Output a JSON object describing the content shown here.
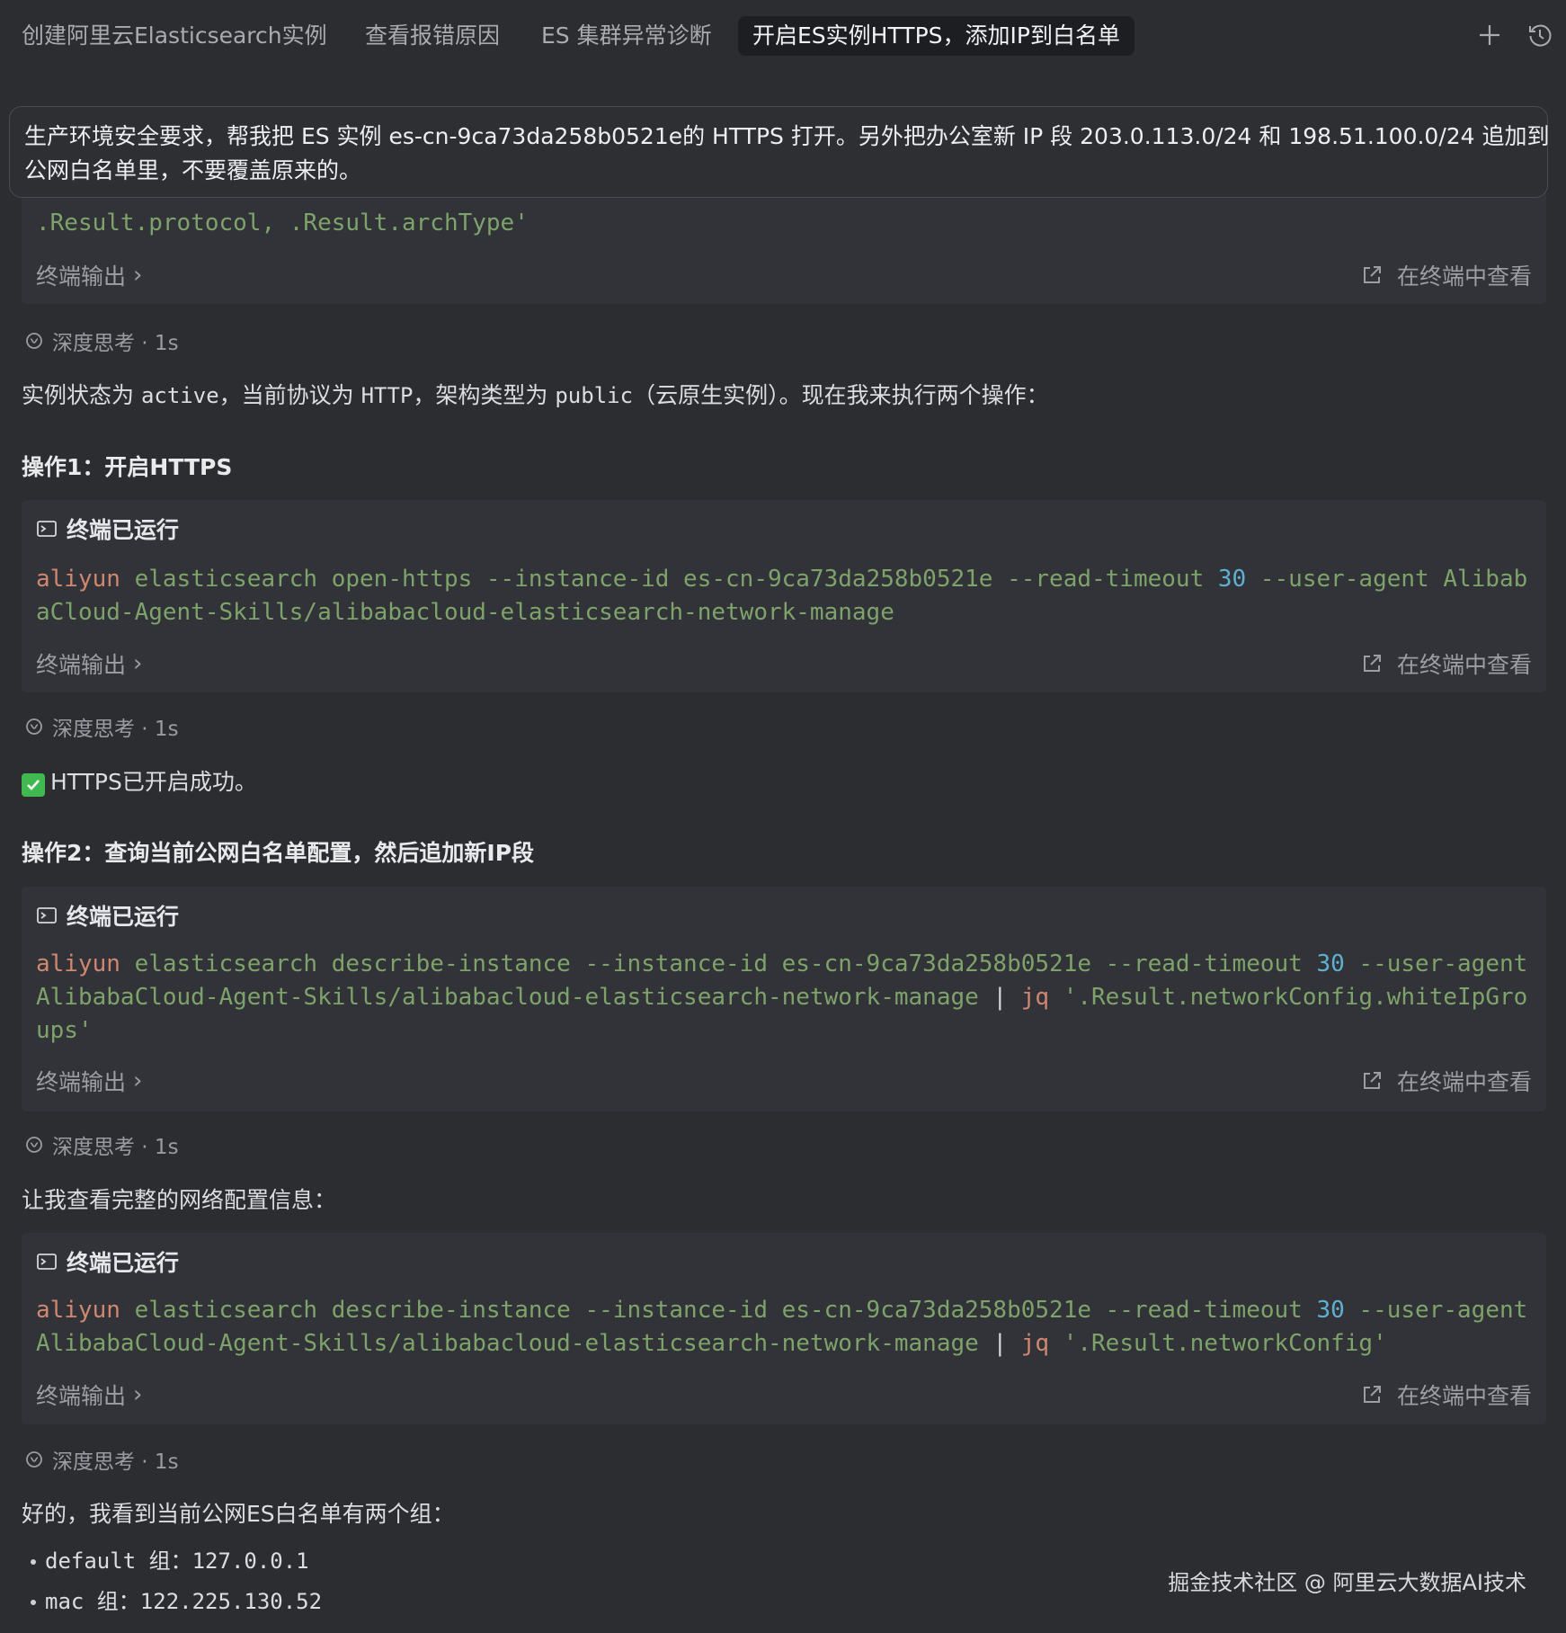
{
  "tabs": [
    {
      "label": "创建阿里云Elasticsearch实例"
    },
    {
      "label": "查看报错原因"
    },
    {
      "label": "ES 集群异常诊断"
    },
    {
      "label": "开启ES实例HTTPS，添加IP到白名单"
    }
  ],
  "prompt": {
    "line1": "生产环境安全要求，帮我把 ES 实例 es-cn-9ca73da258b0521e的 HTTPS 打开。另外把办公室新 IP 段 203.0.113.0/24 和 198.51.100.0/24 追加到",
    "line2": "公网白名单里，不要覆盖原来的。"
  },
  "card0": {
    "code_partial": ".Result.protocol, .Result.archType'",
    "output_label": "终端输出",
    "view_label": "在终端中查看"
  },
  "think_label": "深度思考 · 1s",
  "para1": {
    "pre": "实例状态为 ",
    "c1": "active",
    "mid1": "，当前协议为 ",
    "c2": "HTTP",
    "mid2": "，架构类型为 ",
    "c3": "public",
    "post": "（云原生实例）。现在我来执行两个操作："
  },
  "heading1": "操作1：开启HTTPS",
  "terminal_ran": "终端已运行",
  "cmd1": {
    "aliyun": "aliyun",
    "rest1": " elasticsearch open-https --instance-id es-cn-9ca73da258b0521e --read-timeout ",
    "num": "30",
    "rest2": " --user-agent AlibabaCloud-Agent-Skills/alibabacloud-elasticsearch-network-manage"
  },
  "success_text": "HTTPS已开启成功。",
  "heading2": "操作2：查询当前公网白名单配置，然后追加新IP段",
  "cmd2": {
    "aliyun": "aliyun",
    "rest1": " elasticsearch describe-instance --instance-id es-cn-9ca73da258b0521e --read-timeout ",
    "num": "30",
    "rest2": " --user-agent AlibabaCloud-Agent-Skills/alibabacloud-elasticsearch-network-manage ",
    "pipe": "|",
    "jq": " jq",
    "arg": " '.Result.networkConfig.whiteIpGroups'"
  },
  "para2": "让我查看完整的网络配置信息：",
  "cmd3": {
    "aliyun": "aliyun",
    "rest1": " elasticsearch describe-instance --instance-id es-cn-9ca73da258b0521e --read-timeout ",
    "num": "30",
    "rest2": " --user-agent AlibabaCloud-Agent-Skills/alibabacloud-elasticsearch-network-manage ",
    "pipe": "|",
    "jq": " jq",
    "arg": " '.Result.networkConfig'"
  },
  "para3": "好的，我看到当前公网ES白名单有两个组：",
  "groups": [
    {
      "text": "default 组：127.0.0.1"
    },
    {
      "text": "mac 组：122.225.130.52"
    }
  ],
  "watermark": "掘金技术社区 @ 阿里云大数据AI技术",
  "colors": {
    "background": "#2b2d31",
    "card": "#313338",
    "command_keyword": "#d08770",
    "command_text": "#7ea36a",
    "number": "#5fb0d0",
    "success": "#3fb950"
  }
}
